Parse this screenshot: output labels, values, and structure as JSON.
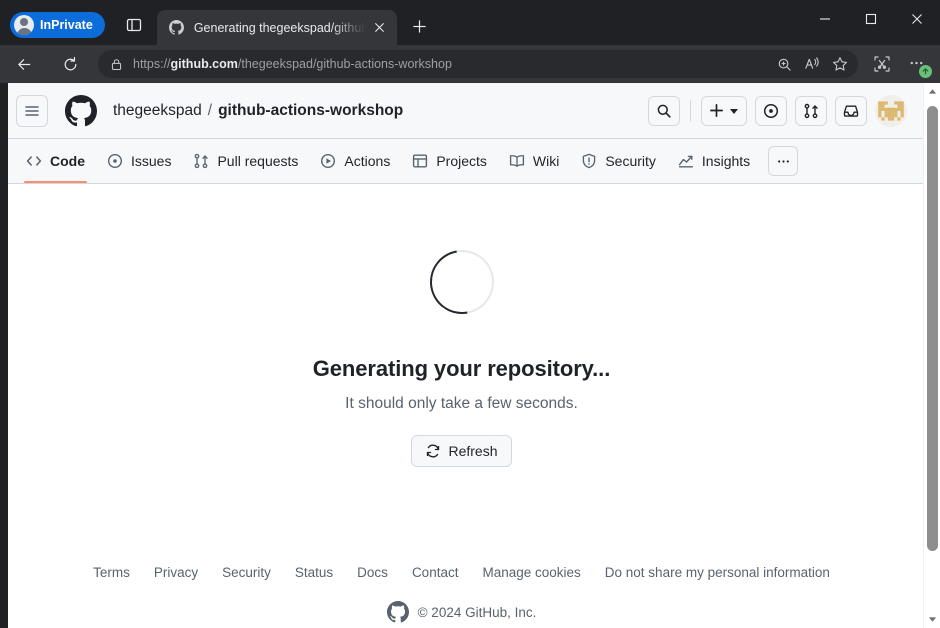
{
  "browser": {
    "inprivate_label": "InPrivate",
    "tab_search_icon": "tab-search-icon",
    "tab": {
      "favicon": "github-favicon",
      "title": "Generating thegeekspad/github-actions-workshop",
      "close_icon": "close-icon"
    },
    "new_tab_icon": "plus-icon",
    "window_controls": {
      "minimize": "minimize-icon",
      "maximize": "maximize-icon",
      "close": "close-icon"
    },
    "toolbar": {
      "back_icon": "back-arrow-icon",
      "reload_icon": "reload-icon",
      "lock_icon": "lock-icon",
      "url_scheme": "https://",
      "url_host": "github.com",
      "url_path": "/thegeekspad/github-actions-workshop",
      "url_full": "https://github.com/thegeekspad/github-actions-workshop",
      "zoom_icon": "zoom-magnifier-icon",
      "read_aloud_icon": "read-aloud-icon",
      "favorite_icon": "star-icon",
      "split_screen_icon": "split-screen-icon",
      "settings_icon": "ellipsis-icon",
      "update_badge_icon": "arrow-up-badge-icon"
    },
    "scrollbar": {
      "up_icon": "scroll-up-arrow-icon",
      "down_icon": "scroll-down-arrow-icon"
    }
  },
  "github": {
    "header": {
      "hamburger_icon": "hamburger-menu-icon",
      "logo_icon": "github-mark-icon",
      "owner": "thegeekspad",
      "separator": "/",
      "repo": "github-actions-workshop",
      "search_icon": "search-icon",
      "create_new_icon": "plus-icon",
      "create_new_caret": "chevron-down-icon",
      "issues_icon": "issue-opened-icon",
      "pull_requests_icon": "git-pull-request-icon",
      "inbox_icon": "inbox-icon",
      "avatar": "user-avatar"
    },
    "nav": [
      {
        "label": "Code",
        "icon": "code-icon",
        "active": true
      },
      {
        "label": "Issues",
        "icon": "issue-opened-icon",
        "active": false
      },
      {
        "label": "Pull requests",
        "icon": "git-pull-request-icon",
        "active": false
      },
      {
        "label": "Actions",
        "icon": "play-icon",
        "active": false
      },
      {
        "label": "Projects",
        "icon": "table-icon",
        "active": false
      },
      {
        "label": "Wiki",
        "icon": "book-icon",
        "active": false
      },
      {
        "label": "Security",
        "icon": "shield-icon",
        "active": false
      },
      {
        "label": "Insights",
        "icon": "graph-icon",
        "active": false
      }
    ],
    "nav_more_icon": "ellipsis-icon",
    "main": {
      "spinner": "loading-spinner",
      "title": "Generating your repository...",
      "subtitle": "It should only take a few seconds.",
      "refresh_label": "Refresh",
      "refresh_icon": "sync-icon"
    },
    "footer": {
      "links": [
        "Terms",
        "Privacy",
        "Security",
        "Status",
        "Docs",
        "Contact",
        "Manage cookies",
        "Do not share my personal information"
      ],
      "logo_icon": "github-mark-icon",
      "copyright": "© 2024 GitHub, Inc."
    }
  },
  "colors": {
    "accent_underline": "#fd8c73",
    "browser_chrome": "#202124",
    "toolbar_bg": "#35363a",
    "inprivate_blue": "#0b6cda",
    "gh_header_bg": "#f6f8fa",
    "gh_border": "#d1d9e0",
    "gh_text": "#1f2328",
    "gh_muted": "#59636e",
    "update_badge_green": "#6bbf7b"
  }
}
